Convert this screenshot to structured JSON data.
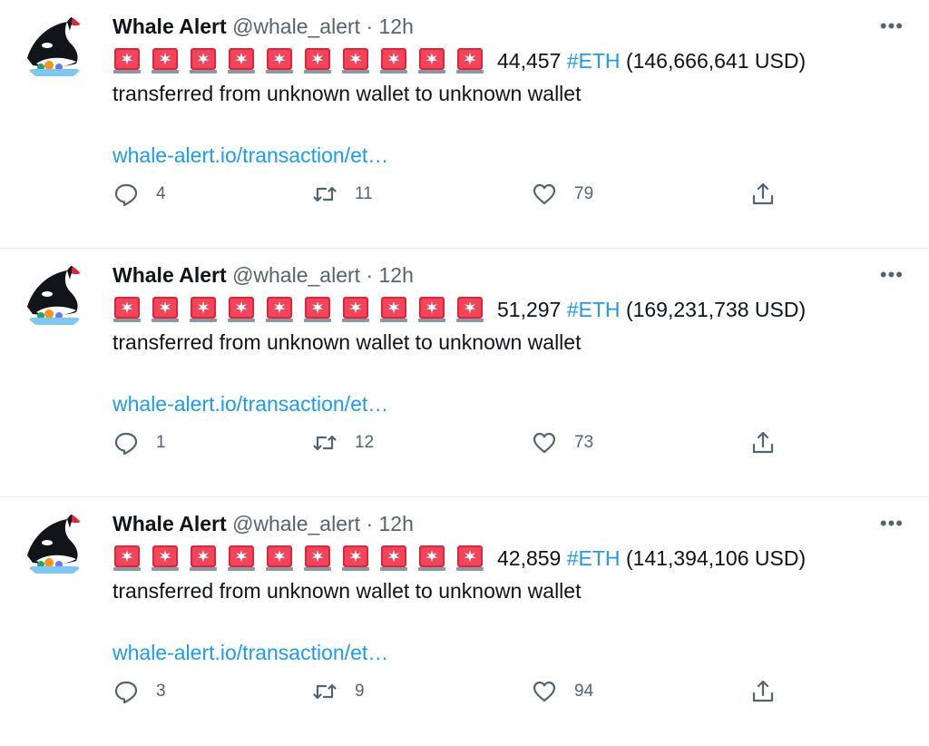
{
  "tweets": [
    {
      "name": "Whale Alert",
      "handle": "@whale_alert",
      "time": "· 12h",
      "amount": "44,457",
      "hashtag": "#ETH",
      "usd": "(146,666,641 USD)",
      "text": "transferred from unknown wallet to unknown wallet",
      "link": "whale-alert.io/transaction/et…",
      "replies": "4",
      "retweets": "11",
      "likes": "79"
    },
    {
      "name": "Whale Alert",
      "handle": "@whale_alert",
      "time": "· 12h",
      "amount": "51,297",
      "hashtag": "#ETH",
      "usd": "(169,231,738 USD)",
      "text": "transferred from unknown wallet to unknown wallet",
      "link": "whale-alert.io/transaction/et…",
      "replies": "1",
      "retweets": "12",
      "likes": "73"
    },
    {
      "name": "Whale Alert",
      "handle": "@whale_alert",
      "time": "· 12h",
      "amount": "42,859",
      "hashtag": "#ETH",
      "usd": "(141,394,106 USD)",
      "text": "transferred from unknown wallet to unknown wallet",
      "link": "whale-alert.io/transaction/et…",
      "replies": "3",
      "retweets": "9",
      "likes": "94"
    }
  ],
  "siren_count": 10,
  "icons": {
    "more": "more-dots-icon",
    "siren": "police-siren-emoji-icon",
    "reply": "reply-bubble-icon",
    "retweet": "retweet-icon",
    "like": "heart-icon",
    "share": "share-upload-icon"
  },
  "colors": {
    "link": "#1d9bf0",
    "text": "#0f1419",
    "muted": "#536471",
    "siren": "#e0243a",
    "divider": "#e6ecf0"
  }
}
